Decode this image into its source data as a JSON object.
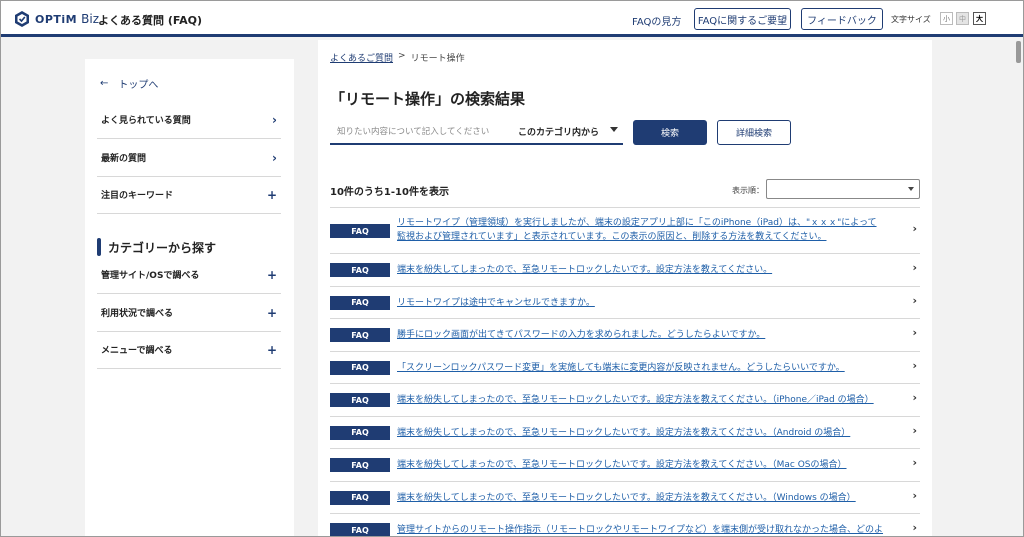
{
  "header": {
    "logo_text": "OPTiM",
    "logo_biz": "Biz",
    "site_title": "よくある質問 (FAQ)",
    "nav_link": "FAQの見方",
    "request_button": "FAQに関するご要望",
    "feedback_button": "フィードバック",
    "font_size_label": "文字サイズ",
    "font_size_small": "小",
    "font_size_mid": "中",
    "font_size_large": "大",
    "accent_color": "#1f3c73"
  },
  "sidebar": {
    "back_label": "トップへ",
    "items": [
      {
        "label": "よく見られている質問",
        "mark": "›"
      },
      {
        "label": "最新の質問",
        "mark": "›"
      },
      {
        "label": "注目のキーワード",
        "mark": "+"
      }
    ],
    "category_heading": "カテゴリーから探す",
    "category_items": [
      {
        "label": "管理サイト/OSで調べる",
        "mark": "+"
      },
      {
        "label": "利用状況で調べる",
        "mark": "+"
      },
      {
        "label": "メニューで調べる",
        "mark": "+"
      }
    ]
  },
  "main": {
    "breadcrumb": {
      "home": "よくあるご質問",
      "sep": ">",
      "current": "リモート操作"
    },
    "title": "「リモート操作」の検索結果",
    "search": {
      "placeholder": "知りたい内容について記入してください",
      "value": ""
    },
    "category_select": "このカテゴリ内から",
    "search_button": "検索",
    "advanced_button": "詳細検索",
    "result_count": "10件のうち1-10件を表示",
    "sort_label": "表示順：",
    "sort_value": "",
    "badge": "FAQ",
    "results": [
      {
        "line1": "リモートワイプ（管理領域）を実行しましたが、端末の設定アプリ上部に「このiPhone（iPad）は、\"ｘｘｘ\"によって",
        "line2": "監視および管理されています」と表示されています。この表示の原因と、削除する方法を教えてください。"
      },
      {
        "line1": "端末を紛失してしまったので、至急リモートロックしたいです。設定方法を教えてください。"
      },
      {
        "line1": "リモートワイプは途中でキャンセルできますか。"
      },
      {
        "line1": "勝手にロック画面が出てきてパスワードの入力を求められました。どうしたらよいですか。"
      },
      {
        "line1": "「スクリーンロックパスワード変更」を実施しても端末に変更内容が反映されません。どうしたらいいですか。"
      },
      {
        "line1": "端末を紛失してしまったので、至急リモートロックしたいです。設定方法を教えてください。（iPhone／iPad の場合）"
      },
      {
        "line1": "端末を紛失してしまったので、至急リモートロックしたいです。設定方法を教えてください。（Android の場合）"
      },
      {
        "line1": "端末を紛失してしまったので、至急リモートロックしたいです。設定方法を教えてください。（Mac OSの場合）"
      },
      {
        "line1": "端末を紛失してしまったので、至急リモートロックしたいです。設定方法を教えてください。（Windows の場合）"
      },
      {
        "line1": "管理サイトからのリモート操作指示（リモートロックやリモートワイプなど）を端末側が受け取れなかった場合、どのよ"
      }
    ]
  }
}
